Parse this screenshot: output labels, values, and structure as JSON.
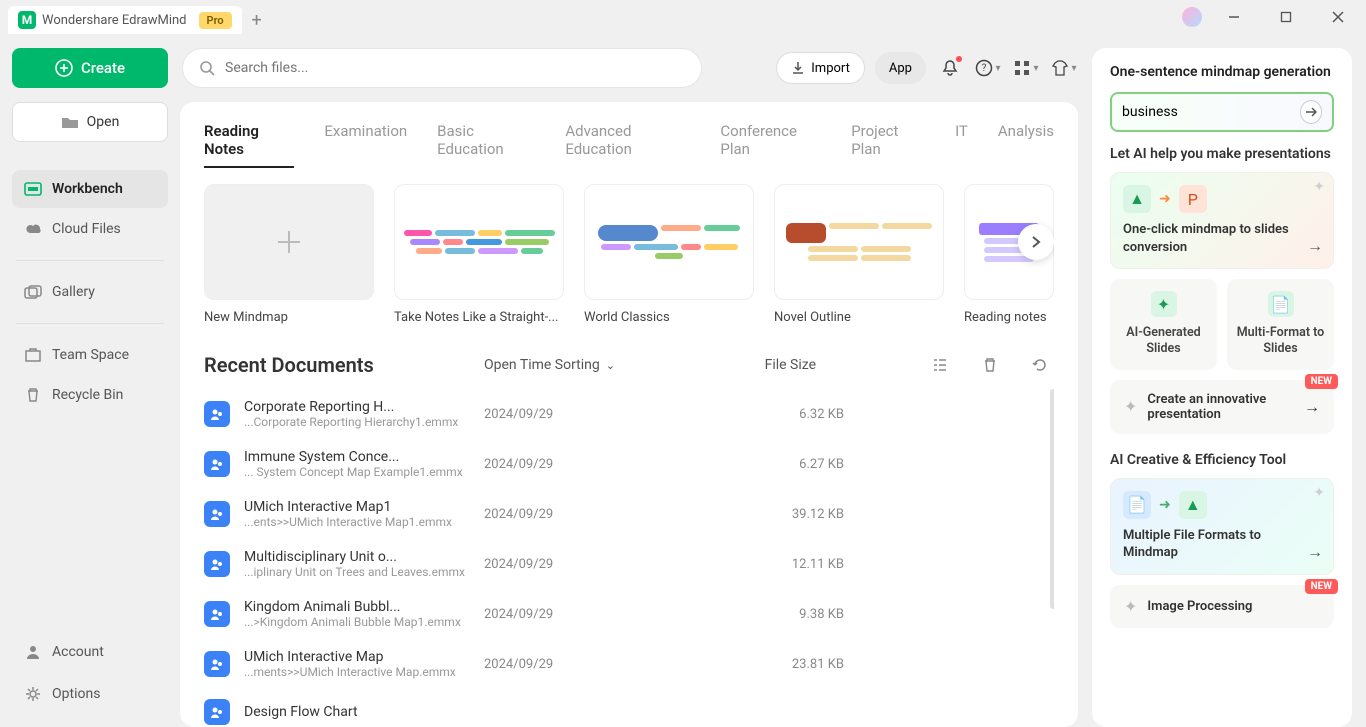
{
  "titlebar": {
    "app_name": "Wondershare EdrawMind",
    "pro": "Pro"
  },
  "sidebar": {
    "create": "Create",
    "open": "Open",
    "nav": {
      "workbench": "Workbench",
      "cloud": "Cloud Files",
      "gallery": "Gallery",
      "team": "Team Space",
      "recycle": "Recycle Bin"
    },
    "bottom": {
      "account": "Account",
      "options": "Options"
    }
  },
  "topbar": {
    "search_placeholder": "Search files...",
    "import": "Import",
    "app": "App"
  },
  "tabs": {
    "t0": "Reading Notes",
    "t1": "Examination",
    "t2": "Basic Education",
    "t3": "Advanced Education",
    "t4": "Conference Plan",
    "t5": "Project Plan",
    "t6": "IT",
    "t7": "Analysis"
  },
  "templates": {
    "new": "New Mindmap",
    "c1": "Take Notes Like a Straight-...",
    "c2": "World Classics",
    "c3": "Novel Outline",
    "c4": "Reading notes"
  },
  "recent": {
    "title": "Recent Documents",
    "sort": "Open Time Sorting",
    "size_col": "File Size",
    "items": [
      {
        "name": "Corporate Reporting H...",
        "path": "...Corporate Reporting Hierarchy1.emmx",
        "date": "2024/09/29",
        "size": "6.32 KB"
      },
      {
        "name": "Immune System Conce...",
        "path": "... System Concept Map Example1.emmx",
        "date": "2024/09/29",
        "size": "6.27 KB"
      },
      {
        "name": "UMich Interactive Map1",
        "path": "...ents>>UMich Interactive Map1.emmx",
        "date": "2024/09/29",
        "size": "39.12 KB"
      },
      {
        "name": "Multidisciplinary Unit o...",
        "path": "...iplinary Unit on Trees and Leaves.emmx",
        "date": "2024/09/29",
        "size": "12.11 KB"
      },
      {
        "name": "Kingdom Animali Bubbl...",
        "path": "...>Kingdom Animali Bubble Map1.emmx",
        "date": "2024/09/29",
        "size": "9.38 KB"
      },
      {
        "name": "UMich Interactive Map",
        "path": "...ments>>UMich Interactive Map.emmx",
        "date": "2024/09/29",
        "size": "23.81 KB"
      },
      {
        "name": "Design Flow Chart",
        "path": "",
        "date": "",
        "size": ""
      }
    ]
  },
  "right": {
    "gen_title": "One-sentence mindmap generation",
    "gen_value": "business",
    "pres_title": "Let AI help you make presentations",
    "oneclick": "One-click mindmap to slides conversion",
    "ai_slides": "AI-Generated Slides",
    "multi_format": "Multi-Format to Slides",
    "innovative": "Create an innovative presentation",
    "tool_title": "AI Creative & Efficiency Tool",
    "multifile": "Multiple File Formats to Mindmap",
    "imgproc": "Image Processing",
    "new_badge": "NEW"
  }
}
